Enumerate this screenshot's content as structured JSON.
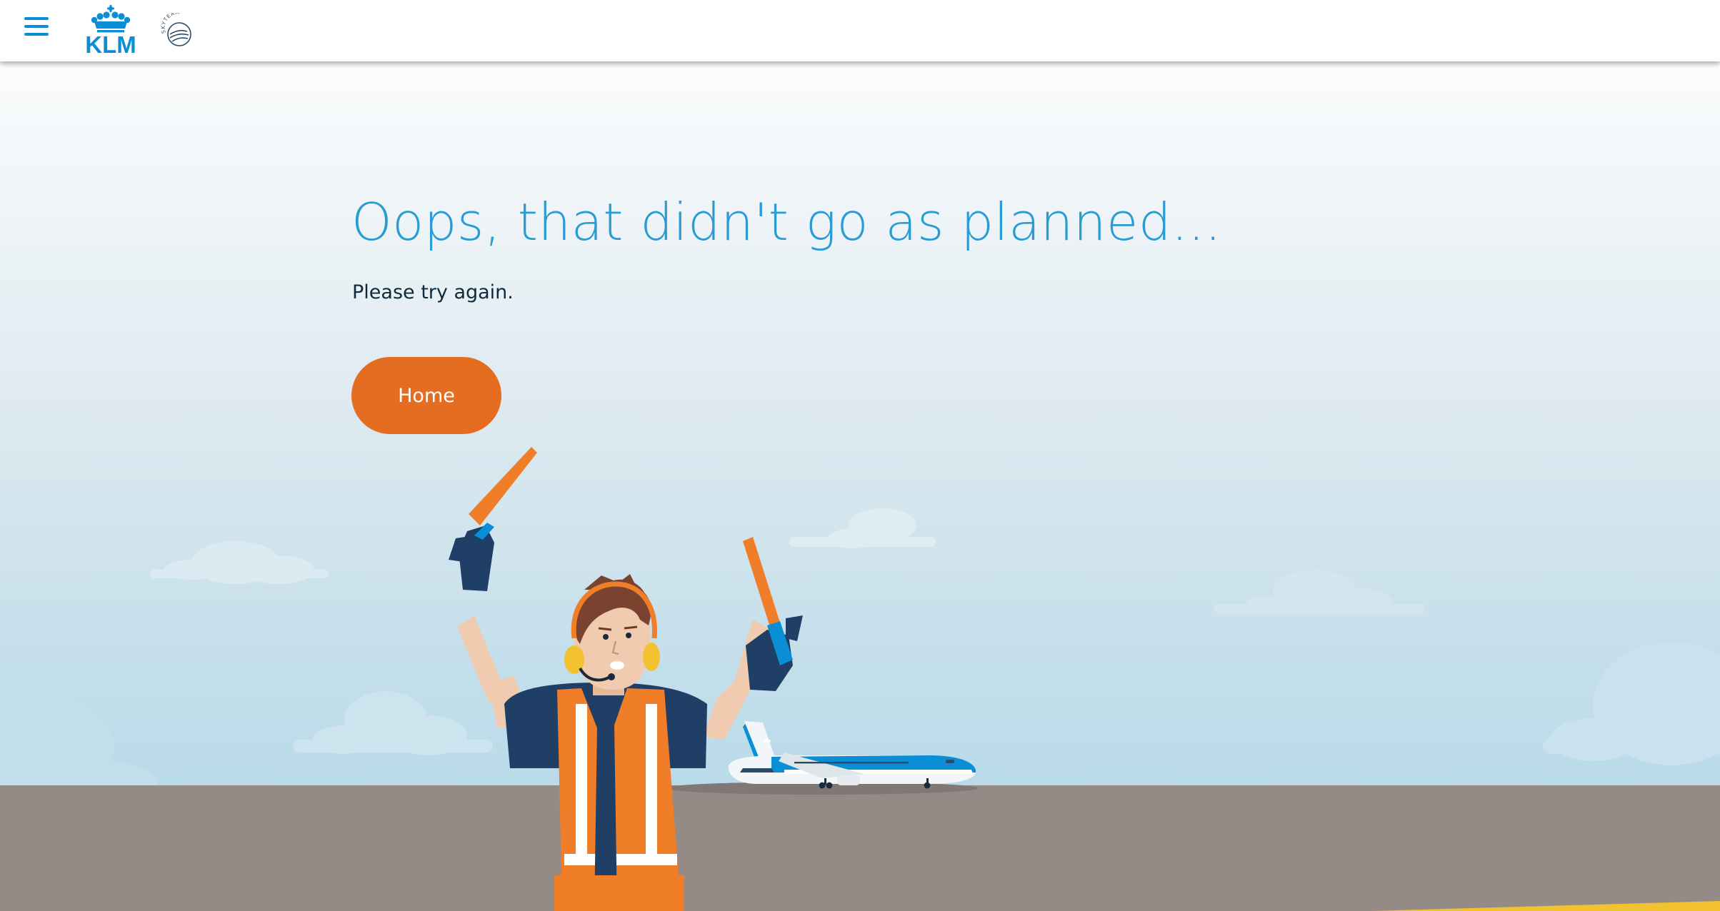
{
  "header": {
    "menu_icon": "hamburger-menu-icon",
    "logo": "KLM",
    "alliance_logo": "SKYTEAM"
  },
  "error": {
    "title": "Oops, that didn't go as planned...",
    "message": "Please try again.",
    "home_button_label": "Home"
  },
  "illustration": {
    "character": "aircraft-marshaller",
    "aircraft_livery": "KLM"
  },
  "colors": {
    "brand_blue": "#0a8fd6",
    "title_blue": "#2b9bd4",
    "button_orange": "#e56d22",
    "body_text": "#0e2a3f",
    "tarmac": "#958b86"
  }
}
